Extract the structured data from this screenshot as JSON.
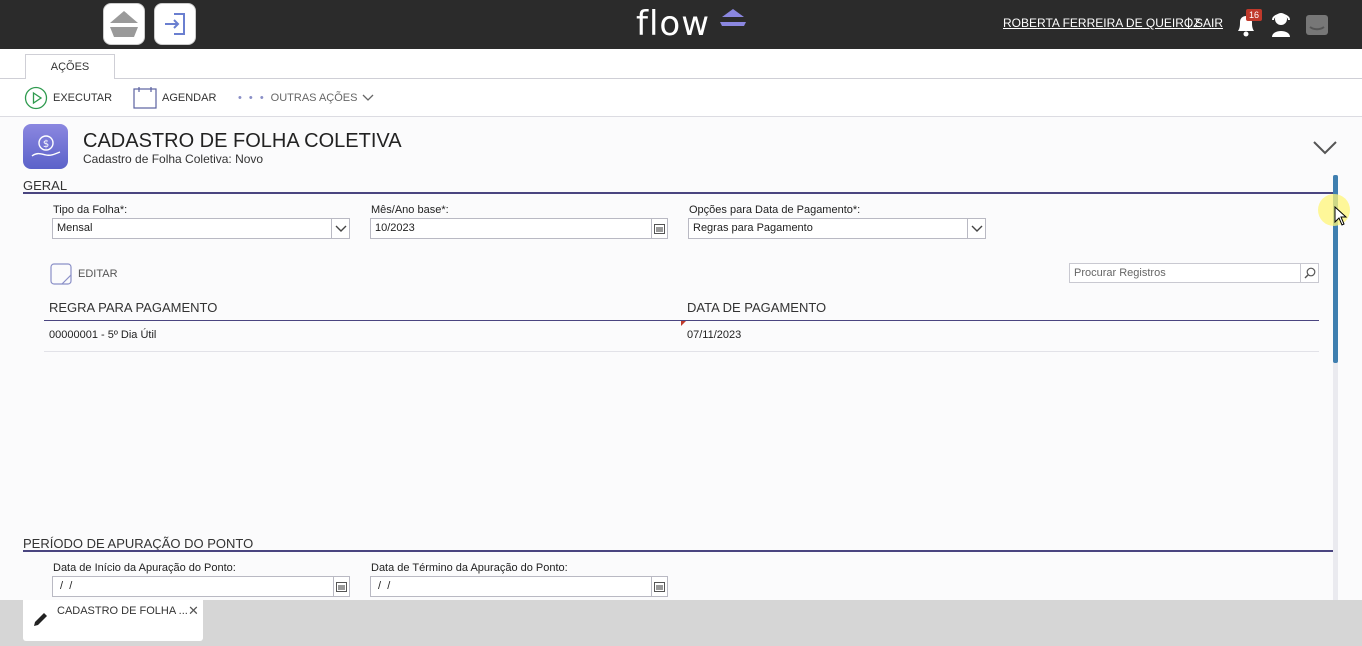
{
  "topbar": {
    "logo_text": "flow",
    "user_name": "ROBERTA FERREIRA DE QUEIROZ",
    "separator": "|",
    "logout": "SAIR",
    "notifications_count": "16"
  },
  "tabs": [
    {
      "label": "AÇÕES"
    }
  ],
  "toolbar": {
    "execute": "EXECUTAR",
    "schedule": "AGENDAR",
    "more": "OUTRAS AÇÕES"
  },
  "header": {
    "title": "CADASTRO DE FOLHA COLETIVA",
    "subtitle": "Cadastro de Folha Coletiva: Novo"
  },
  "geral": {
    "title": "GERAL",
    "tipo_label": "Tipo da Folha*:",
    "tipo_value": "Mensal",
    "mes_label": "Mês/Ano base*:",
    "mes_value": "10/2023",
    "opcoes_label": "Opções para Data de Pagamento*:",
    "opcoes_value": "Regras para Pagamento",
    "edit_label": "EDITAR",
    "search_placeholder": "Procurar Registros",
    "columns": [
      "REGRA PARA PAGAMENTO",
      "DATA DE PAGAMENTO"
    ],
    "rows": [
      [
        "00000001 - 5º Dia Útil",
        "07/11/2023"
      ]
    ]
  },
  "periodo": {
    "title": "PERÍODO DE APURAÇÃO DO PONTO",
    "inicio_label": "Data de Início da Apuração do Ponto:",
    "inicio_value": " /  /",
    "termino_label": "Data de Término da Apuração do Ponto:",
    "termino_value": " /  /"
  },
  "bottom_tab": {
    "label": "CADASTRO DE FOLHA ...",
    "close": "✕"
  },
  "colors": {
    "topbar": "#2b2b2b",
    "accent": "#4a4580",
    "logo_accent": "#8b87e0",
    "badge": "#c0392b",
    "scroll_thumb": "#3f7fb0"
  }
}
